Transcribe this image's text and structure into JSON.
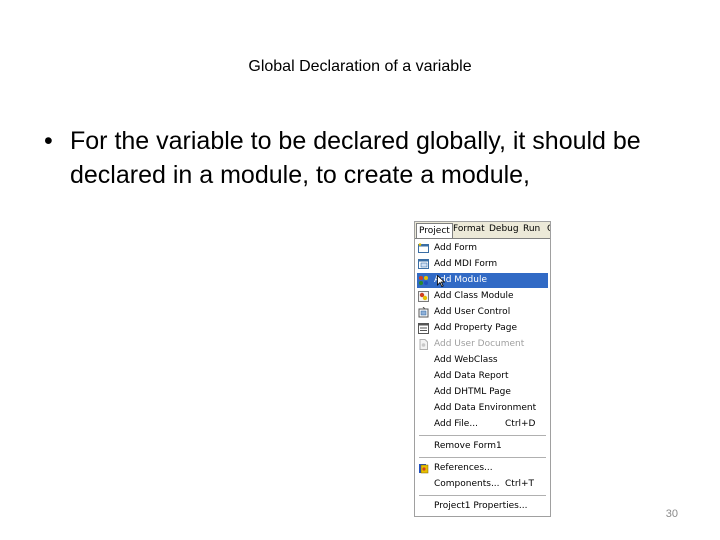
{
  "slide": {
    "title": "Global Declaration of a variable",
    "bullet_marker": "•",
    "bullet_text": "For the variable to be declared globally, it should be declared in a module, to create a module,",
    "page_number": "30"
  },
  "menubar": {
    "items": [
      "Project",
      "Format",
      "Debug",
      "Run",
      "Q"
    ]
  },
  "menu": {
    "items": [
      {
        "label": "Add Form",
        "icon": "form-icon"
      },
      {
        "label": "Add MDI Form",
        "icon": "mdi-form-icon"
      },
      {
        "label": "Add Module",
        "icon": "module-icon",
        "highlighted": true
      },
      {
        "label": "Add Class Module",
        "icon": "class-module-icon"
      },
      {
        "label": "Add User Control",
        "icon": "user-control-icon"
      },
      {
        "label": "Add Property Page",
        "icon": "property-page-icon"
      },
      {
        "label": "Add User Document",
        "icon": "user-document-icon",
        "disabled": true
      },
      {
        "label": "Add WebClass"
      },
      {
        "label": "Add Data Report"
      },
      {
        "label": "Add DHTML Page"
      },
      {
        "label": "Add Data Environment"
      },
      {
        "label": "Add File...",
        "shortcut": "Ctrl+D"
      },
      {
        "label": "Remove Form1"
      },
      {
        "label": "References...",
        "icon": "references-icon"
      },
      {
        "label": "Components...",
        "shortcut": "Ctrl+T"
      },
      {
        "label": "Project1 Properties..."
      }
    ]
  },
  "colors": {
    "highlight": "#316ac5",
    "menubar_bg": "#ece9d8",
    "disabled_text": "#a0a0a0"
  }
}
